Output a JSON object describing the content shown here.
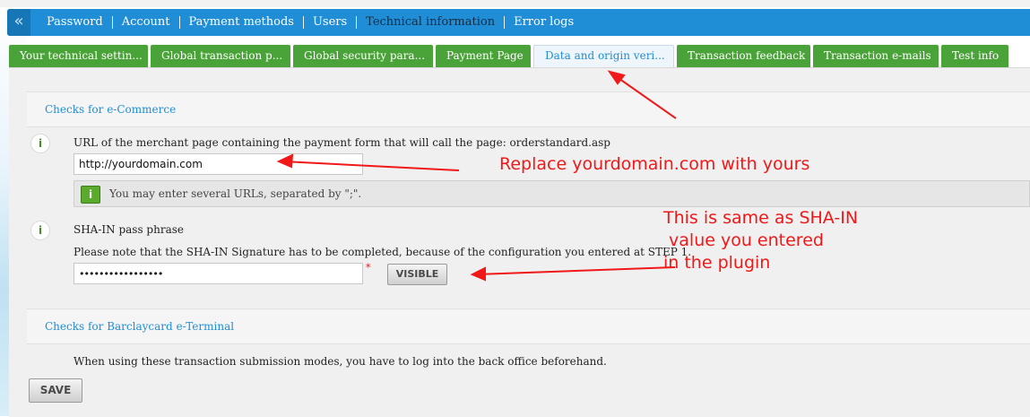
{
  "nav": {
    "back_icon": "chevron-left-icon",
    "items": [
      {
        "label": "Password"
      },
      {
        "label": "Account"
      },
      {
        "label": "Payment methods"
      },
      {
        "label": "Users"
      },
      {
        "label": "Technical information",
        "active": true
      },
      {
        "label": "Error logs"
      }
    ]
  },
  "tabs": [
    {
      "label": "Your technical settin..."
    },
    {
      "label": "Global transaction p..."
    },
    {
      "label": "Global security para..."
    },
    {
      "label": "Payment Page"
    },
    {
      "label": "Data and origin veri...",
      "active": true
    },
    {
      "label": "Transaction feedback"
    },
    {
      "label": "Transaction e-mails"
    },
    {
      "label": "Test info"
    }
  ],
  "ecommerce": {
    "title": "Checks for e-Commerce",
    "url_label": "URL of the merchant page containing the payment form that will call the page: orderstandard.asp",
    "url_value": "http://yourdomain.com",
    "url_hint": "You may enter several URLs, separated by \";\".",
    "sha_label": "SHA-IN pass phrase",
    "sha_note": "Please note that the SHA-IN Signature has to be completed, because of the configuration you entered at STEP 1.",
    "sha_value": "•••••••••••••••••",
    "required_mark": "*",
    "visible_button": "VISIBLE"
  },
  "eterminal": {
    "title": "Checks for Barclaycard e-Terminal",
    "note": "When using these transaction submission modes, you have to log into the back office beforehand."
  },
  "save_button": "SAVE",
  "annotations": {
    "replace": "Replace yourdomain.com with yours",
    "sha_line1": "This is same as SHA-IN",
    "sha_line2": " value you entered",
    "sha_line3": "in the plugin"
  },
  "colors": {
    "nav_blue": "#1f8ed6",
    "tab_green": "#4aa338",
    "annotation_red": "#f01818"
  }
}
